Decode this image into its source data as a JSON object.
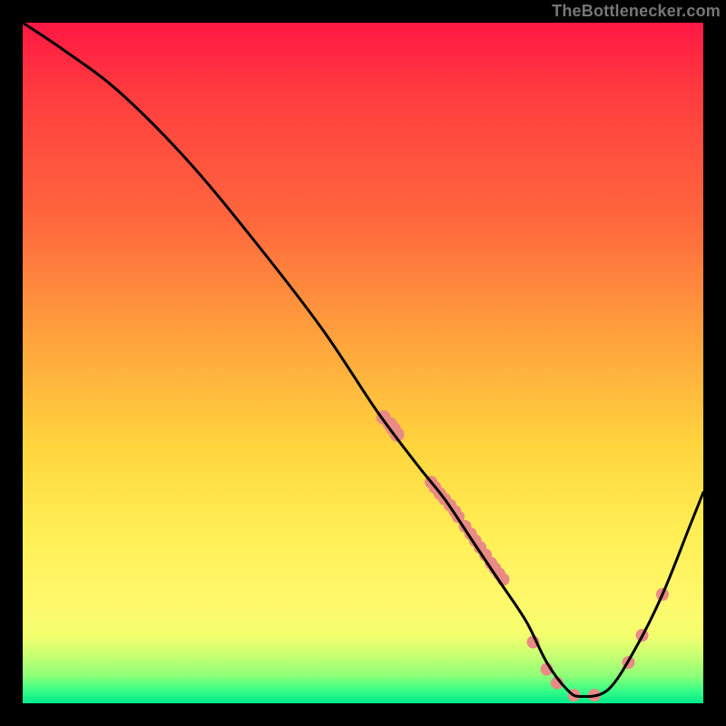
{
  "attribution_text": "TheBottlenecker.com",
  "colors": {
    "curve_stroke": "#000000",
    "dot_fill": "#e98a84",
    "gradient_stops": [
      "#ff1744",
      "#ff3b3f",
      "#ff6a3d",
      "#ffa83d",
      "#ffd43d",
      "#ffef55",
      "#fff86b",
      "#f4ff6e",
      "#c8ff78",
      "#3dff85",
      "#00e98c"
    ]
  },
  "chart_data": {
    "type": "line",
    "title": "",
    "xlabel": "",
    "ylabel": "",
    "xlim": [
      0,
      100
    ],
    "ylim": [
      0,
      100
    ],
    "grid": false,
    "legend": false,
    "notes": "Background heat gradient from red (top, high y) through orange/yellow to green (bottom, low y). Black V-shaped curve overlaid. Salmon dots are data markers clustered near and around the trough of the curve.",
    "series": [
      {
        "name": "bottleneck-curve",
        "x": [
          0,
          6,
          14,
          24,
          34,
          44,
          52,
          58,
          62,
          66,
          70,
          74,
          77,
          80,
          82,
          86,
          90,
          94,
          98,
          100
        ],
        "y": [
          100,
          96,
          90,
          80,
          68,
          55,
          43,
          35,
          30,
          24,
          18,
          12,
          6,
          2,
          1,
          2,
          8,
          16,
          26,
          31
        ]
      }
    ],
    "scatter_points": {
      "name": "markers",
      "x": [
        53,
        54,
        54.5,
        55,
        60,
        60.6,
        61.3,
        62,
        62.8,
        63.5,
        64,
        65,
        65.8,
        66.5,
        67.2,
        68,
        68.8,
        69.4,
        70,
        70.6,
        75,
        77,
        78.5,
        81,
        84,
        89,
        91,
        94
      ],
      "y": [
        42,
        41,
        40.3,
        39.5,
        32.5,
        31.7,
        30.8,
        30,
        29.1,
        28.2,
        27.4,
        26,
        24.9,
        23.9,
        22.9,
        21.8,
        20.6,
        19.8,
        19,
        18.2,
        9,
        5,
        3,
        1.2,
        1.2,
        6,
        10,
        16
      ],
      "r": [
        8,
        8,
        8,
        8,
        7,
        7,
        7,
        7,
        7,
        7,
        7,
        7,
        7,
        7,
        7,
        7,
        7,
        7,
        7,
        7,
        7,
        7,
        7,
        7,
        7,
        7,
        7,
        7
      ]
    }
  }
}
